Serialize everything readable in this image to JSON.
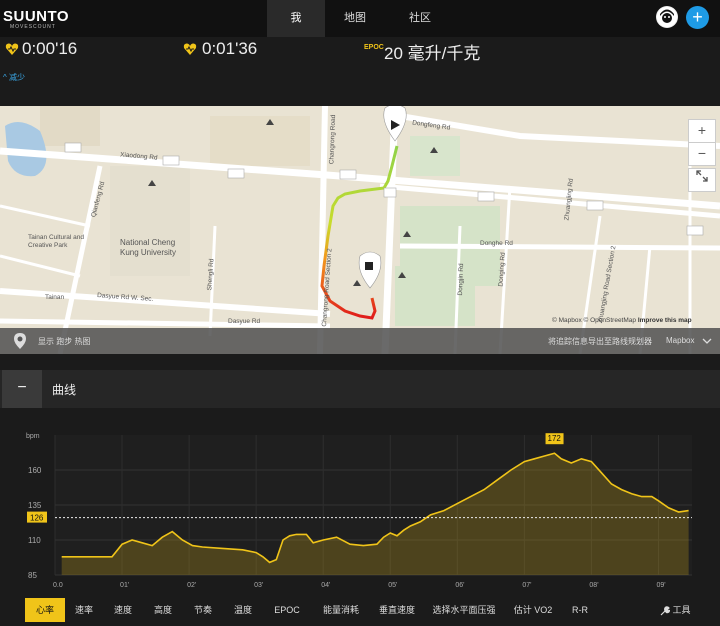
{
  "app": {
    "logo": "SUUNTO",
    "logo_sub": "MOVESCOUNT"
  },
  "nav": {
    "me": "我",
    "map": "地图",
    "community": "社区",
    "add": "+"
  },
  "stats": {
    "time1": "0:00'16",
    "time2": "0:01'36",
    "epoc_label": "EPOC",
    "epoc_value": "20 毫升/千克",
    "collapse": "^ 减少"
  },
  "map": {
    "labels": {
      "dongfeng": "Dongfeng Rd",
      "xiaodong": "Xiaodong Rd",
      "qianfeng": "Qianfeng Rd",
      "changrong": "Changrong Road",
      "changrong_sec": "Changrong Road Section 2",
      "donghe": "Donghe Rd",
      "dasyue_w": "Dasyue Rd W. Sec.",
      "dasyue": "Dasyue Rd",
      "shengli": "Shengli Rd",
      "dongjin": "Dongjin Rd",
      "donging": "Donging Rd",
      "zhuangjing": "Zhuangjing Rd",
      "zhuangjing_sec": "Zhuangjing Road Section 2",
      "tainan_park": "Tainan Cultural and Creative Park",
      "tainan": "Tainan",
      "ncku": "National Cheng Kung University",
      "r180": "180",
      "r27": "27"
    },
    "bottom_left": "显示 跑步 热图",
    "bottom_right": "将追踪信息导出至路线规划器",
    "mapbox": "Mapbox",
    "credit_a": "© Mapbox © OpenStreetMap",
    "credit_b": "Improve this map",
    "zoom_in": "+",
    "zoom_out": "−"
  },
  "curve": {
    "title": "曲线",
    "collapse": "−"
  },
  "chart_data": {
    "type": "area",
    "ylabel": "bpm",
    "y_ticks": [
      85,
      110,
      135,
      160
    ],
    "ylim": [
      85,
      185
    ],
    "x_ticks": [
      "0.0",
      "01'",
      "02'",
      "03'",
      "04'",
      "05'",
      "06'",
      "07'",
      "08'",
      "09'"
    ],
    "xlim": [
      0,
      9.5
    ],
    "avg_label": "126",
    "avg_value": 126,
    "max_label": "172",
    "max_value": 172,
    "series": [
      {
        "values": [
          [
            0.1,
            98
          ],
          [
            0.5,
            98
          ],
          [
            0.85,
            98
          ],
          [
            1.0,
            107
          ],
          [
            1.15,
            110
          ],
          [
            1.3,
            108
          ],
          [
            1.45,
            106
          ],
          [
            1.6,
            112
          ],
          [
            1.75,
            116
          ],
          [
            1.9,
            110
          ],
          [
            2.05,
            106
          ],
          [
            2.2,
            105
          ],
          [
            2.5,
            104
          ],
          [
            2.8,
            103
          ],
          [
            3.0,
            101
          ],
          [
            3.1,
            98
          ],
          [
            3.2,
            94
          ],
          [
            3.3,
            96
          ],
          [
            3.4,
            110
          ],
          [
            3.5,
            113
          ],
          [
            3.6,
            114
          ],
          [
            3.75,
            114
          ],
          [
            3.85,
            108
          ],
          [
            4.0,
            110
          ],
          [
            4.2,
            112
          ],
          [
            4.4,
            107
          ],
          [
            4.6,
            106
          ],
          [
            4.8,
            107
          ],
          [
            4.9,
            112
          ],
          [
            5.0,
            115
          ],
          [
            5.1,
            113
          ],
          [
            5.2,
            117
          ],
          [
            5.3,
            120
          ],
          [
            5.45,
            123
          ],
          [
            5.6,
            128
          ],
          [
            5.8,
            131
          ],
          [
            6.0,
            136
          ],
          [
            6.2,
            141
          ],
          [
            6.4,
            146
          ],
          [
            6.6,
            153
          ],
          [
            6.8,
            160
          ],
          [
            7.0,
            166
          ],
          [
            7.15,
            168
          ],
          [
            7.3,
            170
          ],
          [
            7.45,
            172
          ],
          [
            7.55,
            168
          ],
          [
            7.7,
            165
          ],
          [
            7.85,
            168
          ],
          [
            8.0,
            166
          ],
          [
            8.15,
            158
          ],
          [
            8.3,
            150
          ],
          [
            8.45,
            146
          ],
          [
            8.6,
            143
          ],
          [
            8.75,
            141
          ],
          [
            8.9,
            141
          ],
          [
            9.0,
            138
          ],
          [
            9.15,
            133
          ],
          [
            9.3,
            130
          ],
          [
            9.45,
            131
          ],
          [
            9.55,
            128
          ],
          [
            9.7,
            130
          ],
          [
            9.85,
            132
          ],
          [
            10.0,
            130
          ],
          [
            10.1,
            128
          ],
          [
            10.2,
            127
          ],
          [
            10.3,
            126
          ]
        ]
      }
    ]
  },
  "tabs": [
    "心率",
    "速率",
    "速度",
    "高度",
    "节奏",
    "温度",
    "EPOC",
    "能量消耗",
    "垂直速度",
    "选择水平面压强",
    "估计 VO2",
    "R-R"
  ],
  "tools": "工具",
  "colors": {
    "accent": "#f0c419",
    "link": "#3aa7e6",
    "route_start": "#8fd24a",
    "route_end": "#e01b1b"
  }
}
